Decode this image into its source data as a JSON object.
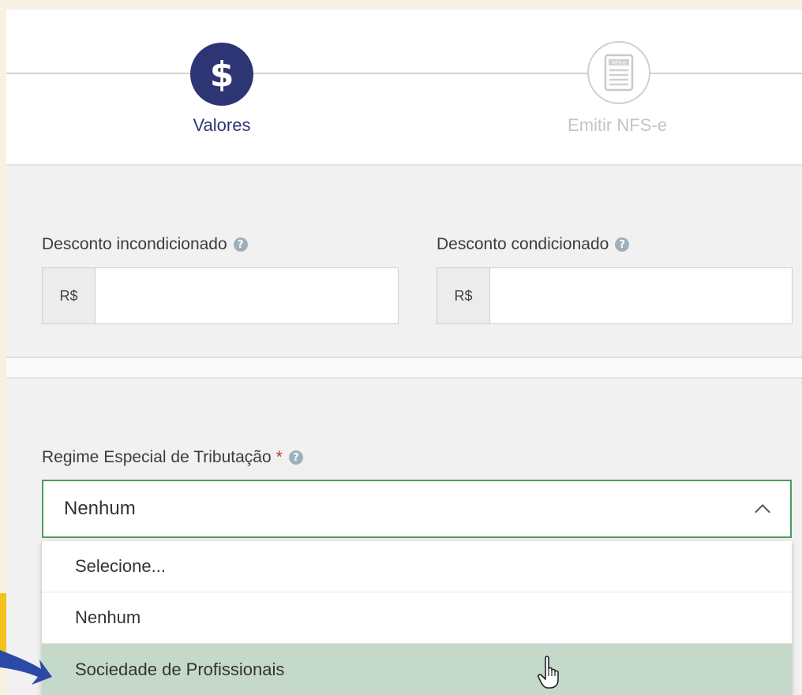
{
  "stepper": {
    "steps": [
      {
        "label": "Valores",
        "icon": "dollar-icon",
        "glyph": "$",
        "state": "active"
      },
      {
        "label": "Emitir NFS-e",
        "icon": "nfse-document-icon",
        "doc_text": "NFS-e",
        "state": "inactive"
      }
    ]
  },
  "discounts": {
    "unconditional": {
      "label": "Desconto incondicionado",
      "prefix": "R$",
      "value": ""
    },
    "conditional": {
      "label": "Desconto condicionado",
      "prefix": "R$",
      "value": ""
    }
  },
  "tax_regime": {
    "label": "Regime Especial de Tributação",
    "required_mark": "*",
    "selected": "Nenhum",
    "options": [
      "Selecione...",
      "Nenhum",
      "Sociedade de Profissionais"
    ],
    "highlighted_option": "Sociedade de Profissionais"
  },
  "help_glyph": "?",
  "colors": {
    "primary": "#2e3575",
    "focus_border": "#4e9a5a",
    "highlight": "#c5d9cb",
    "required": "#c0392b",
    "accent_yellow": "#f2c21b"
  }
}
